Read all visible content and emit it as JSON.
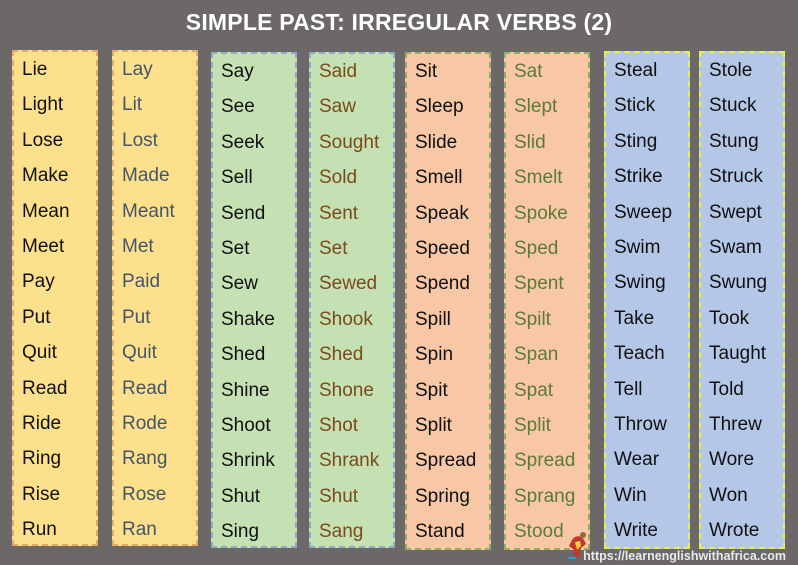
{
  "title": "SIMPLE PAST: IRREGULAR VERBS (2)",
  "columns": [
    {
      "type": "base",
      "theme": "yellow",
      "words": [
        "Lie",
        "Light",
        "Lose",
        "Make",
        "Mean",
        "Meet",
        "Pay",
        "Put",
        "Quit",
        "Read",
        "Ride",
        "Ring",
        "Rise",
        "Run"
      ]
    },
    {
      "type": "past",
      "theme": "yellow",
      "words": [
        "Lay",
        "Lit",
        "Lost",
        "Made",
        "Meant",
        "Met",
        "Paid",
        "Put",
        "Quit",
        "Read",
        "Rode",
        "Rang",
        "Rose",
        "Ran"
      ]
    },
    {
      "type": "base",
      "theme": "green",
      "words": [
        "Say",
        "See",
        "Seek",
        "Sell",
        "Send",
        "Set",
        "Sew",
        "Shake",
        "Shed",
        "Shine",
        "Shoot",
        "Shrink",
        "Shut",
        "Sing"
      ]
    },
    {
      "type": "past",
      "theme": "green",
      "words": [
        "Said",
        "Saw",
        "Sought",
        "Sold",
        "Sent",
        "Set",
        "Sewed",
        "Shook",
        "Shed",
        "Shone",
        "Shot",
        "Shrank",
        "Shut",
        "Sang"
      ]
    },
    {
      "type": "base",
      "theme": "orange",
      "words": [
        "Sit",
        "Sleep",
        "Slide",
        "Smell",
        "Speak",
        "Speed",
        "Spend",
        "Spill",
        "Spin",
        "Spit",
        "Split",
        "Spread",
        "Spring",
        "Stand"
      ]
    },
    {
      "type": "past",
      "theme": "orange",
      "words": [
        "Sat",
        "Slept",
        "Slid",
        "Smelt",
        "Spoke",
        "Sped",
        "Spent",
        "Spilt",
        "Span",
        "Spat",
        "Split",
        "Spread",
        "Sprang",
        "Stood"
      ]
    },
    {
      "type": "base",
      "theme": "blue",
      "words": [
        "Steal",
        "Stick",
        "Sting",
        "Strike",
        "Sweep",
        "Swim",
        "Swing",
        "Take",
        "Teach",
        "Tell",
        "Throw",
        "Wear",
        "Win",
        "Write"
      ]
    },
    {
      "type": "past",
      "theme": "blue",
      "words": [
        "Stole",
        "Stuck",
        "Stung",
        "Struck",
        "Swept",
        "Swam",
        "Swung",
        "Took",
        "Taught",
        "Told",
        "Threw",
        "Wore",
        "Won",
        "Wrote"
      ]
    }
  ],
  "footer": {
    "url": "https://learnenglishwithafrica.com",
    "logo_icon": "africa-map-mascot-icon"
  }
}
